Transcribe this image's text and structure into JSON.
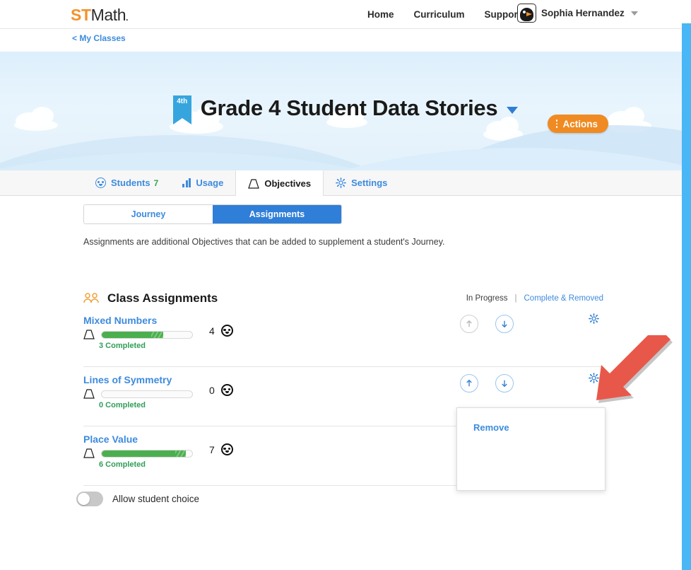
{
  "topnav": {
    "logo_st": "ST",
    "logo_math": "Math",
    "logo_dot": ".",
    "links": [
      {
        "label": "Home",
        "name": "nav-home"
      },
      {
        "label": "Curriculum",
        "name": "nav-curriculum"
      },
      {
        "label": "Support",
        "name": "nav-support"
      }
    ],
    "user_name": "Sophia Hernandez",
    "avatar_icon": "penguin-avatar-icon",
    "chevron_icon": "chevron-down-icon"
  },
  "breadcrumb": {
    "label": "< My Classes"
  },
  "hero": {
    "grade_badge": "4th",
    "title": "Grade 4 Student Data Stories",
    "title_chevron_icon": "chevron-down-icon",
    "actions_label": "Actions",
    "actions_icon": "kebab-menu-icon",
    "accent_orange": "#ef8b22",
    "sky_color": "#e3f1fb"
  },
  "tabs": [
    {
      "label": "Students",
      "count": "7",
      "icon": "smiley-face-icon",
      "active": false
    },
    {
      "label": "Usage",
      "count": "",
      "icon": "bar-chart-icon",
      "active": false
    },
    {
      "label": "Objectives",
      "count": "",
      "icon": "trapezoid-icon",
      "active": true
    },
    {
      "label": "Settings",
      "count": "",
      "icon": "gear-icon",
      "active": false
    }
  ],
  "segmented": {
    "journey_label": "Journey",
    "assignments_label": "Assignments",
    "selected": "Assignments"
  },
  "description": "Assignments are additional Objectives that can be added to supplement a student's Journey.",
  "section": {
    "title": "Class Assignments",
    "icon": "people-icon",
    "filter_active": "In Progress",
    "filter_separator": "|",
    "filter_link": "Complete & Removed"
  },
  "assignments": [
    {
      "name": "Mixed Numbers",
      "progress_pct": 55,
      "stripe_pct": 13,
      "student_count": "4",
      "completed_label": "3 Completed",
      "up_enabled": false,
      "down_enabled": true
    },
    {
      "name": "Lines of Symmetry",
      "progress_pct": 0,
      "stripe_pct": 0,
      "student_count": "0",
      "completed_label": "0 Completed",
      "up_enabled": true,
      "down_enabled": true
    },
    {
      "name": "Place Value",
      "progress_pct": 81,
      "stripe_pct": 12,
      "student_count": "7",
      "completed_label": "6 Completed",
      "up_enabled": true,
      "down_enabled": false
    }
  ],
  "context_menu": {
    "remove_label": "Remove"
  },
  "student_choice": {
    "label": "Allow student choice",
    "enabled": false
  },
  "annotation": {
    "arrow_color": "#e8584a",
    "icon": "annotation-arrow-icon"
  },
  "colors": {
    "blue_link": "#3d8bde",
    "blue_active": "#2f7ed8",
    "green_bar": "#4caf4f",
    "green_text": "#2e9e57",
    "scrollbar": "#49b6f5"
  }
}
